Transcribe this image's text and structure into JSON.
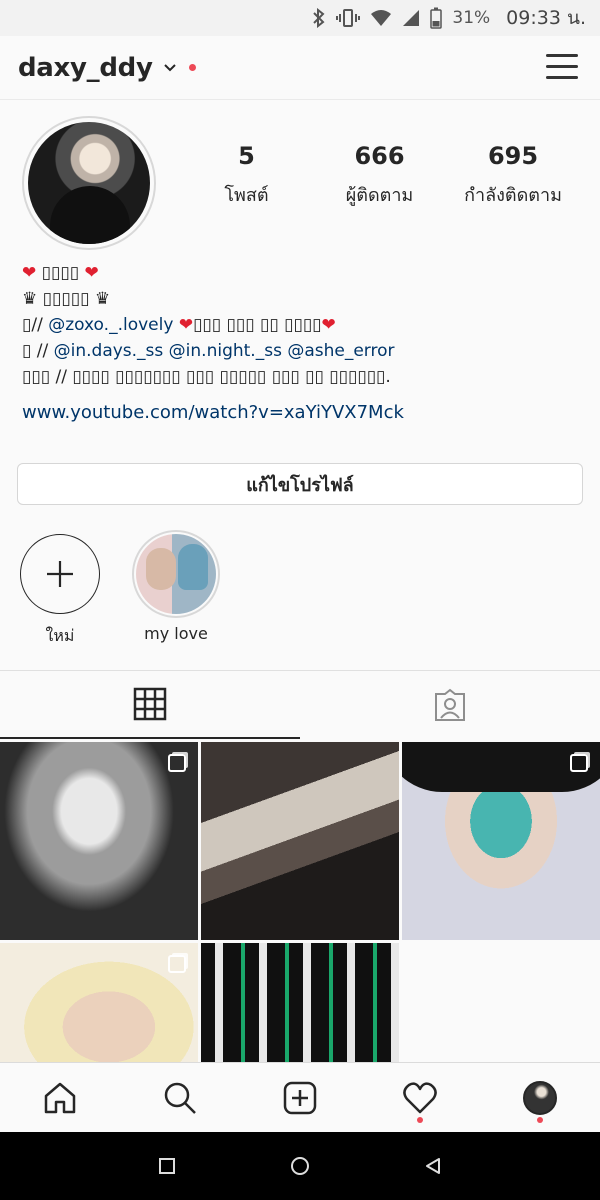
{
  "status_bar": {
    "battery": "31%",
    "time": "09:33 น."
  },
  "header": {
    "username": "daxy_ddy"
  },
  "profile": {
    "stats": [
      {
        "value": "5",
        "label": "โพสต์"
      },
      {
        "value": "666",
        "label": "ผู้ติดตาม"
      },
      {
        "value": "695",
        "label": "กำลังติดตาม"
      }
    ]
  },
  "bio": {
    "line1": "▯▯▯▯",
    "line2": "▯▯▯▯▯",
    "line3_prefix": "▯//",
    "line3_mention": "@zoxo._.lovely",
    "line3_suffix": "▯▯▯ ▯▯▯ ▯▯ ▯▯▯▯",
    "line4_prefix": "▯ //",
    "line4_mentions": "@in.days._ss @in.night._ss @ashe_error",
    "line5": "▯▯▯ // ▯▯▯▯ ▯▯▯▯▯▯▯ ▯▯▯ ▯▯▯▯▯ ▯▯▯ ▯▯ ▯▯▯▯▯▯.",
    "link": "www.youtube.com/watch?v=xaYiYVX7Mck"
  },
  "edit_profile_label": "แก้ไขโปรไฟล์",
  "highlights": [
    {
      "label": "ใหม่"
    },
    {
      "label": "my love"
    }
  ],
  "icons": {
    "grid": "grid-icon",
    "tagged": "tagged-icon",
    "home": "home-icon",
    "search": "search-icon",
    "add": "add-icon",
    "heart": "heart-icon",
    "profile": "profile-icon"
  },
  "colors": {
    "notification": "#ed4956",
    "link": "#003569",
    "heart": "#e02030"
  }
}
